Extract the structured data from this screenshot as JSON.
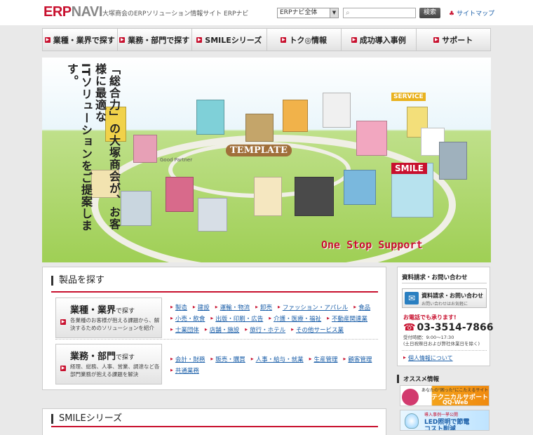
{
  "header": {
    "logo_erp": "ERP",
    "logo_navi": "NAVI",
    "tagline": "大塚商会のERPソリューション情報サイト ERPナビ",
    "site_select": "ERPナビ全体",
    "search_button": "検索",
    "sitemap": "サイトマップ"
  },
  "nav": {
    "items": [
      {
        "label": "業種・業界で探す"
      },
      {
        "label": "業務・部門で探す"
      },
      {
        "label": "SMILEシリーズ"
      },
      {
        "label": "トク◎情報"
      },
      {
        "label": "成功導入事例"
      },
      {
        "label": "サポート"
      }
    ]
  },
  "hero": {
    "copy_lines": [
      "「総合力」の大塚商会が、お客様に最適な",
      "ITソリューションをご提案します。"
    ],
    "template_label": "TEMPLATE",
    "smile_label": "SMILE",
    "service_label": "SERVICE",
    "one_stop": "One Stop Support",
    "good_partner": "Good Partner"
  },
  "products": {
    "title": "製品を探す",
    "industry": {
      "title": "業種・業界",
      "title_suffix": "で探す",
      "desc": "各業種のお客様が抱える課題から、解決するためのソリューションを紹介",
      "links": [
        "製造",
        "建設",
        "運輸・物流",
        "卸売",
        "ファッション・アパレル",
        "食品",
        "小売・飲食",
        "出版・印刷・広告",
        "介護・医療・福祉",
        "不動産関連業",
        "士業団体",
        "店舗・施設",
        "旅行・ホテル",
        "その他サービス業"
      ]
    },
    "department": {
      "title": "業務・部門",
      "title_suffix": "で探す",
      "desc": "経理、総務、人事、営業、調達など各部門業務が抱える課題を解決",
      "links": [
        "会計・財務",
        "販売・購買",
        "人事・給与・就業",
        "生産管理",
        "顧客管理",
        "共通業務"
      ]
    }
  },
  "smile_section": {
    "title": "SMILEシリーズ"
  },
  "contact": {
    "title": "資料請求・お問い合わせ",
    "button_main": "資料請求・お問い合わせ",
    "button_sub": "お問い合わせはお気軽に",
    "phone_label": "お電話でも承ります!",
    "phone": "03-3514-7866",
    "hours_1": "受付時間：9:00～17:30",
    "hours_2": "(土日祝祭日および弊社休業日を除く)",
    "privacy": "個人情報について"
  },
  "recommend": {
    "title": "オススメ情報",
    "qq_small": "あなたの\"困った\"にこたえるサイト",
    "qq_big1": "テクニカルサポート",
    "qq_big2": "QQ-Web",
    "led_small": "導入事例一挙公開",
    "led_big1": "LED照明で節電",
    "led_big2": "コスト削減"
  },
  "colors": {
    "accent_red": "#c8102e",
    "link_blue": "#1a5ea8"
  }
}
